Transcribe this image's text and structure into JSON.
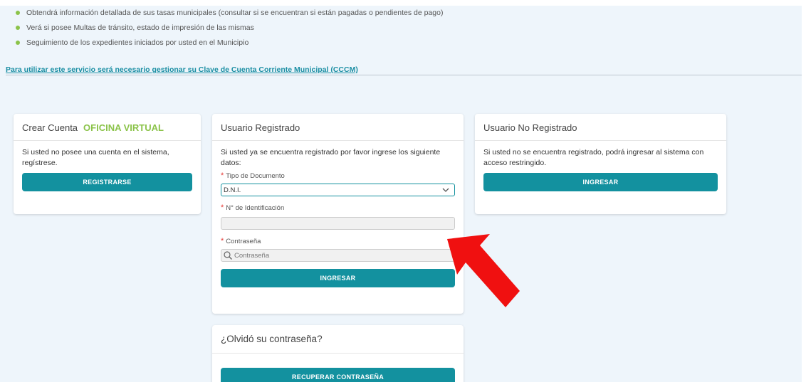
{
  "intro": {
    "bullets": [
      "Obtendrá información detallada de sus tasas municipales (consultar si se encuentran si están pagadas o pendientes de pago)",
      "Verá si posee Multas de tránsito, estado de impresión de las mismas",
      "Seguimiento de los expedientes iniciados por usted en el Municipio"
    ],
    "link": "Para utilizar este servicio será necesario gestionar su Clave de Cuenta Corriente Municipal (CCCM)"
  },
  "create_account": {
    "title": "Crear Cuenta",
    "accent": "OFICINA VIRTUAL",
    "text": "Si usted no posee una cuenta en el sistema, regístrese.",
    "button": "REGISTRARSE"
  },
  "registered": {
    "title": "Usuario Registrado",
    "text": "Si usted ya se encuentra registrado por favor ingrese los siguiente datos:",
    "doc_type_label": "Tipo de Documento",
    "doc_type_value": "D.N.I.",
    "id_label": "N° de Identificación",
    "id_value": "",
    "password_label": "Contraseña",
    "password_placeholder": "Contraseña",
    "button": "INGRESAR"
  },
  "forgot": {
    "title": "¿Olvidó su contraseña?",
    "button": "RECUPERAR CONTRASEÑA"
  },
  "unregistered": {
    "title": "Usuario No Registrado",
    "text": "Si usted no se encuentra registrado, podrá ingresar al sistema con acceso restringido.",
    "button": "INGRESAR"
  },
  "colors": {
    "teal": "#13919f",
    "green": "#8bc34a",
    "required": "#e53935",
    "arrow": "#f01010"
  },
  "icons": [
    "bullet-icon",
    "chevron-down-icon",
    "search-icon",
    "red-arrow-icon"
  ]
}
